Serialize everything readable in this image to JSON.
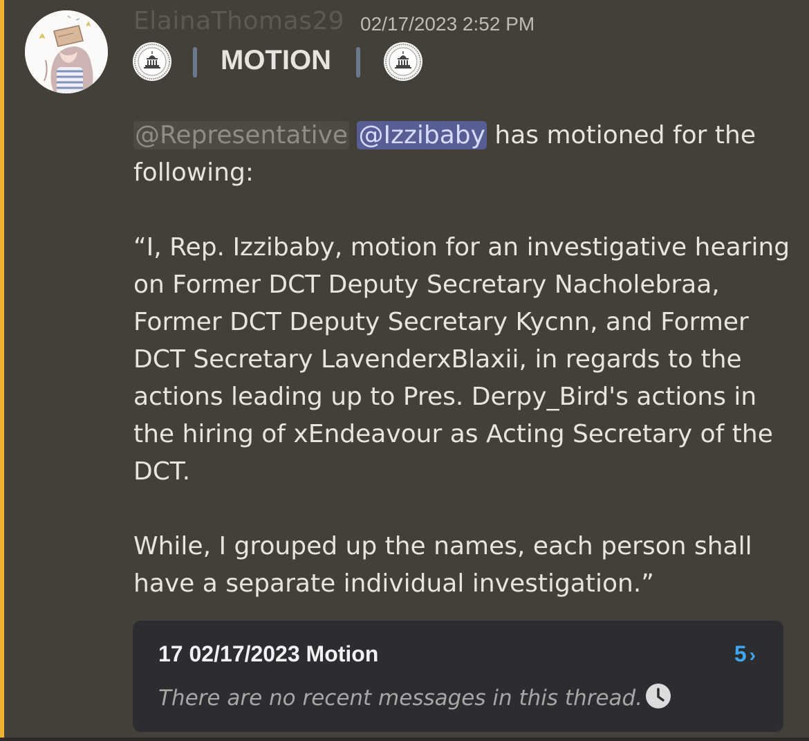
{
  "message": {
    "author": "ElainaThomas29",
    "timestamp": "02/17/2023 2:52 PM",
    "header_title": "MOTION",
    "mentions": {
      "role": "@Representative",
      "user": "@Izzibaby"
    },
    "intro_text": " has motioned for the following:",
    "quote_text": "“I, Rep. Izzibaby, motion for an investigative hearing on Former DCT Deputy Secretary Nacholebraa, Former DCT Deputy Secretary Kycnn, and Former DCT Secretary LavenderxBlaxii, in regards to the actions leading up to Pres. Derpy_Bird's actions in the hiring of xEndeavour as Acting Secretary of the DCT.",
    "closing_text": "While, I grouped up the names, each person shall have a separate individual investigation.”"
  },
  "thread": {
    "title": "17 02/17/2023 Motion",
    "message_count": "5",
    "chevron": "›",
    "empty_text": "There are no recent messages in this thread."
  },
  "icons": {
    "seal": "capitol-seal-icon",
    "clock": "clock-icon",
    "chevron": "chevron-right-icon"
  },
  "colors": {
    "background": "#433f39",
    "mention_highlight_bar": "#f0b232",
    "user_mention_bg": "#575e93",
    "thread_card_bg": "#2c2d31",
    "thread_count": "#3fa7f1"
  }
}
